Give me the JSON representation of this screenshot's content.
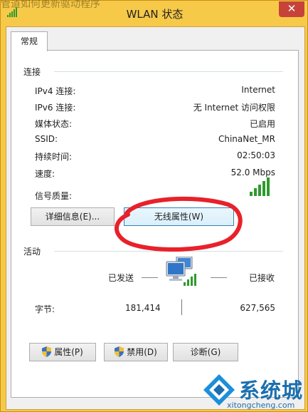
{
  "window": {
    "title": "WLAN 状态",
    "close_glyph": "✕"
  },
  "background_text": "管道如何更新驱动程序",
  "tab": {
    "label": "常规"
  },
  "connection": {
    "group_label": "连接",
    "rows": [
      {
        "label": "IPv4 连接:",
        "value": "Internet"
      },
      {
        "label": "IPv6 连接:",
        "value": "无 Internet 访问权限"
      },
      {
        "label": "媒体状态:",
        "value": "已启用"
      },
      {
        "label": "SSID:",
        "value": "ChinaNet_MR"
      },
      {
        "label": "持续时间:",
        "value": "02:50:03"
      },
      {
        "label": "速度:",
        "value": "52.0 Mbps"
      }
    ],
    "signal_label": "信号质量:",
    "signal_bars": 5,
    "details_button": "详细信息(E)...",
    "wireless_props_button": "无线属性(W)"
  },
  "activity": {
    "group_label": "活动",
    "sent_label": "已发送",
    "received_label": "已接收",
    "bytes_label": "字节:",
    "bytes_sent": "181,414",
    "bytes_received": "627,565"
  },
  "buttons": {
    "properties": "属性(P)",
    "disable": "禁用(D)",
    "diagnose": "诊断(G)"
  },
  "watermark": {
    "text": "系统城",
    "url": "xitongcheng.com"
  },
  "colors": {
    "titlebar": "#f7c948",
    "close_button": "#c7433a",
    "annotation_circle": "#e8212a",
    "watermark": "#1c6fae",
    "signal_green": "#2e9a2e"
  }
}
